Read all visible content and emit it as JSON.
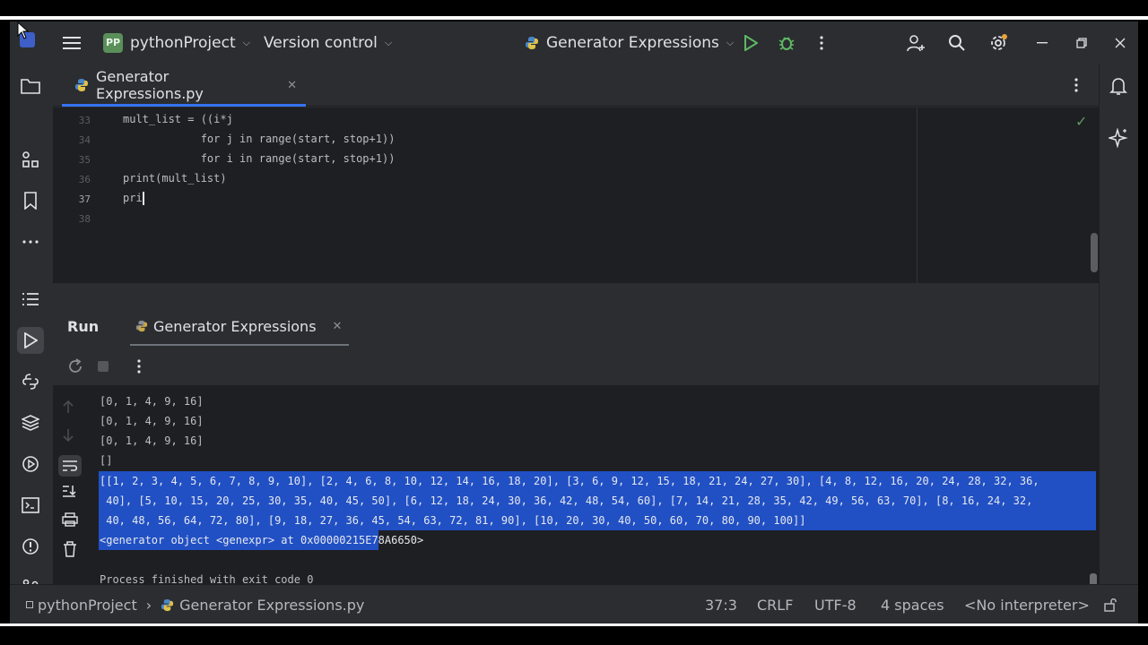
{
  "titlebar": {
    "project_badge": "PP",
    "project_name": "pythonProject",
    "vcs_label": "Version control",
    "run_config": "Generator Expressions"
  },
  "editor_tab": {
    "label": "Generator Expressions.py"
  },
  "editor": {
    "lines": [
      {
        "num": "33",
        "code": "mult_list = ((i*j"
      },
      {
        "num": "34",
        "code": "            for j in range(start, stop+1))"
      },
      {
        "num": "35",
        "code": "            for i in range(start, stop+1))"
      },
      {
        "num": "36",
        "code": "print(mult_list)"
      },
      {
        "num": "37",
        "code": "pri"
      },
      {
        "num": "38",
        "code": ""
      }
    ]
  },
  "run_panel": {
    "title": "Run",
    "tab_label": "Generator Expressions"
  },
  "console": {
    "lines": [
      "[0, 1, 4, 9, 16]",
      "[0, 1, 4, 9, 16]",
      "[0, 1, 4, 9, 16]",
      "[]",
      "[[1, 2, 3, 4, 5, 6, 7, 8, 9, 10], [2, 4, 6, 8, 10, 12, 14, 16, 18, 20], [3, 6, 9, 12, 15, 18, 21, 24, 27, 30], [4, 8, 12, 16, 20, 24, 28, 32, 36,",
      " 40], [5, 10, 15, 20, 25, 30, 35, 40, 45, 50], [6, 12, 18, 24, 30, 36, 42, 48, 54, 60], [7, 14, 21, 28, 35, 42, 49, 56, 63, 70], [8, 16, 24, 32,",
      " 40, 48, 56, 64, 72, 80], [9, 18, 27, 36, 45, 54, 63, 72, 81, 90], [10, 20, 30, 40, 50, 60, 70, 80, 90, 100]]",
      "<generator object <genexpr> at 0x00000215E78A6650>",
      "",
      "Process finished with exit code 0"
    ]
  },
  "statusbar": {
    "breadcrumb_project": "pythonProject",
    "breadcrumb_file": "Generator Expressions.py",
    "position": "37:3",
    "line_ending": "CRLF",
    "encoding": "UTF-8",
    "indent": "4 spaces",
    "interpreter": "<No interpreter>"
  },
  "colors": {
    "window_bg": "#2b2d30",
    "editor_bg": "#1e1f22",
    "accent": "#3574f0",
    "selection": "#2150c4"
  }
}
